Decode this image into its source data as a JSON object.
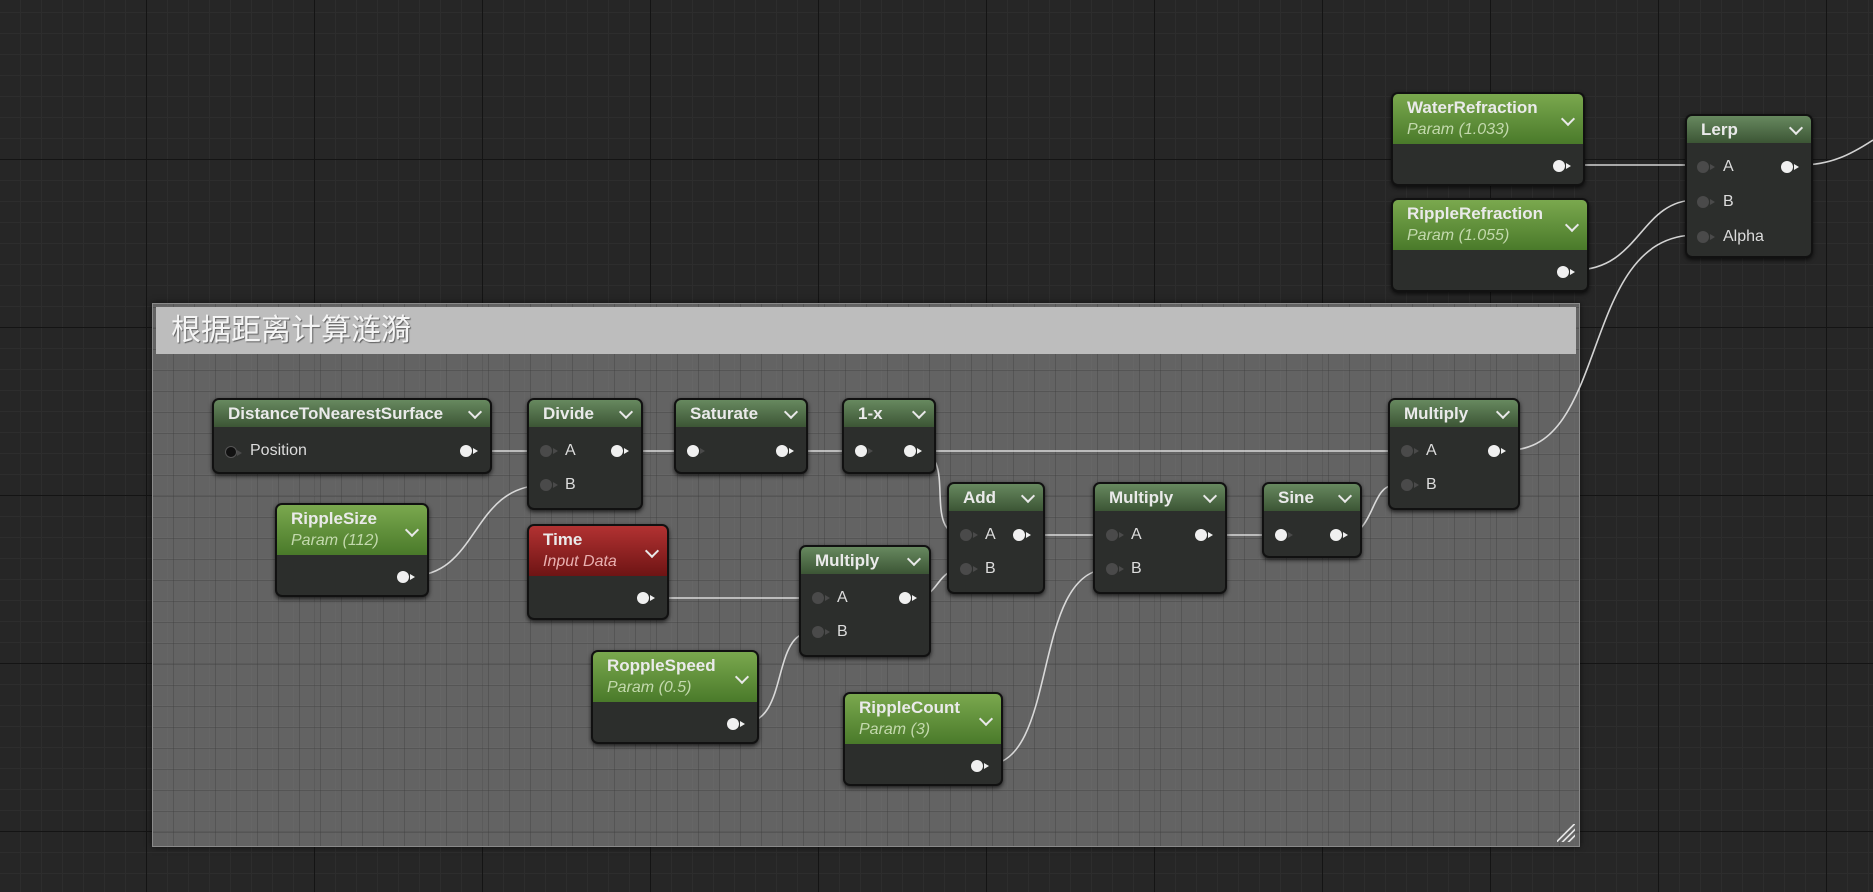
{
  "comment": {
    "title": "根据距离计算涟漪"
  },
  "nodes": {
    "water_refraction": {
      "title": "WaterRefraction",
      "subtitle": "Param (1.033)"
    },
    "ripple_refraction": {
      "title": "RippleRefraction",
      "subtitle": "Param (1.055)"
    },
    "lerp": {
      "title": "Lerp",
      "pins": [
        "A",
        "B",
        "Alpha"
      ]
    },
    "distance_to_nearest_surface": {
      "title": "DistanceToNearestSurface",
      "pins": [
        "Position"
      ]
    },
    "divide": {
      "title": "Divide",
      "pins": [
        "A",
        "B"
      ]
    },
    "saturate": {
      "title": "Saturate"
    },
    "one_minus_x": {
      "title": "1-x"
    },
    "multiply_final": {
      "title": "Multiply",
      "pins": [
        "A",
        "B"
      ]
    },
    "ripple_size": {
      "title": "RippleSize",
      "subtitle": "Param (112)"
    },
    "time": {
      "title": "Time",
      "subtitle": "Input Data"
    },
    "multiply_time": {
      "title": "Multiply",
      "pins": [
        "A",
        "B"
      ]
    },
    "add": {
      "title": "Add",
      "pins": [
        "A",
        "B"
      ]
    },
    "multiply_count": {
      "title": "Multiply",
      "pins": [
        "A",
        "B"
      ]
    },
    "sine": {
      "title": "Sine"
    },
    "ripple_speed": {
      "title": "RoppleSpeed",
      "subtitle": "Param (0.5)"
    },
    "ripple_count": {
      "title": "RippleCount",
      "subtitle": "Param (3)"
    }
  }
}
